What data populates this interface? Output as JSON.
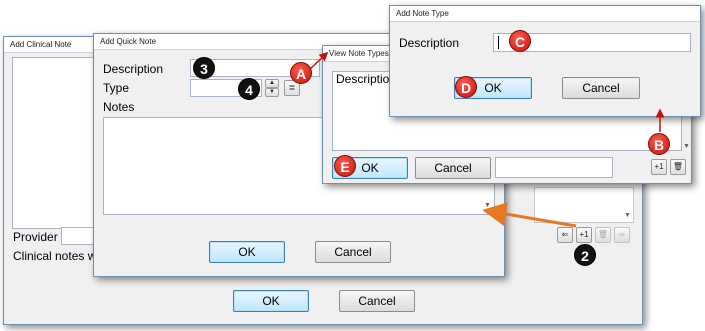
{
  "clinical_note_window": {
    "title": "Add Clinical Note",
    "provider_label": "Provider",
    "clinical_notes_text": "Clinical notes wi",
    "ok_label": "OK",
    "cancel_label": "Cancel",
    "toolbar": {
      "add_label": "+1"
    }
  },
  "quick_note_window": {
    "title": "Add Quick Note",
    "description_label": "Description",
    "type_label": "Type",
    "notes_label": "Notes",
    "ok_label": "OK",
    "cancel_label": "Cancel"
  },
  "view_note_types_window": {
    "title": "View Note Types",
    "description_header": "Description",
    "ok_label": "OK",
    "cancel_label": "Cancel",
    "add_label": "+1"
  },
  "add_note_type_window": {
    "title": "Add Note Type",
    "description_label": "Description",
    "ok_label": "OK",
    "cancel_label": "Cancel"
  },
  "annotations": {
    "marker_2": "2",
    "marker_3": "3",
    "marker_4": "4",
    "marker_a": "A",
    "marker_b": "B",
    "marker_c": "C",
    "marker_d": "D",
    "marker_e": "E"
  },
  "colors": {
    "marker_red": "#d42a1f",
    "arrow_orange": "#e87722",
    "primary_button": "#bee6fd"
  }
}
